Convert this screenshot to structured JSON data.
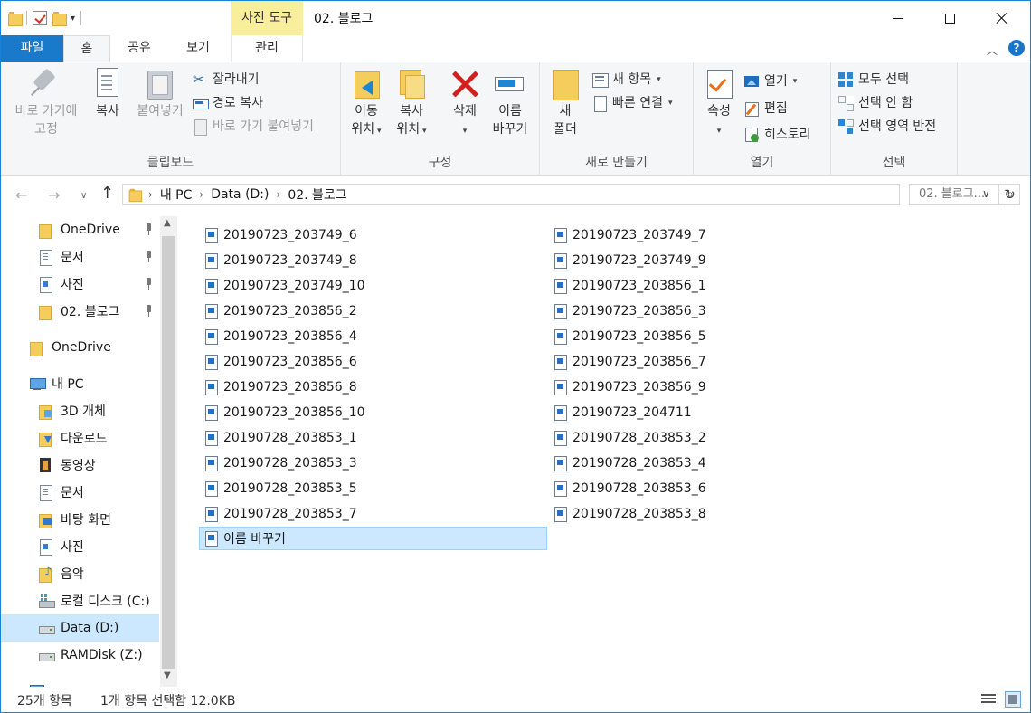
{
  "titlebar": {
    "contextual_tab": "사진 도구",
    "title": "02. 블로그"
  },
  "tabs": {
    "file": "파일",
    "home": "홈",
    "share": "공유",
    "view": "보기",
    "manage": "관리"
  },
  "ribbon": {
    "clipboard": {
      "label": "클립보드",
      "pin_line1": "바로 가기에",
      "pin_line2": "고정",
      "copy": "복사",
      "paste": "붙여넣기",
      "cut": "잘라내기",
      "copy_path": "경로 복사",
      "paste_shortcut": "바로 가기 붙여넣기"
    },
    "organize": {
      "label": "구성",
      "move_line1": "이동",
      "move_line2": "위치",
      "copy_line1": "복사",
      "copy_line2": "위치",
      "delete": "삭제",
      "rename_line1": "이름",
      "rename_line2": "바꾸기"
    },
    "new": {
      "label": "새로 만들기",
      "folder_line1": "새",
      "folder_line2": "폴더",
      "new_item": "새 항목",
      "easy_access": "빠른 연결"
    },
    "open": {
      "label": "열기",
      "properties": "속성",
      "open": "열기",
      "edit": "편집",
      "history": "히스토리"
    },
    "select": {
      "label": "선택",
      "select_all": "모두 선택",
      "select_none": "선택 안 함",
      "invert": "선택 영역 반전"
    }
  },
  "address": {
    "crumbs": [
      "내 PC",
      "Data (D:)",
      "02. 블로그"
    ],
    "search_placeholder": "02. 블로그..."
  },
  "nav": {
    "quick_onedrive": "OneDrive",
    "quick_docs": "문서",
    "quick_pics": "사진",
    "quick_blog": "02. 블로그",
    "onedrive": "OneDrive",
    "pc": "내 PC",
    "objects3d": "3D 개체",
    "downloads": "다운로드",
    "videos": "동영상",
    "docs": "문서",
    "desktop": "바탕 화면",
    "pics": "사진",
    "music": "음악",
    "local_c": "로컬 디스크 (C:)",
    "data_d": "Data (D:)",
    "ramdisk": "RAMDisk (Z:)"
  },
  "files": [
    "20190723_203749_6",
    "20190723_203749_7",
    "20190723_203749_8",
    "20190723_203749_9",
    "20190723_203749_10",
    "20190723_203856_1",
    "20190723_203856_2",
    "20190723_203856_3",
    "20190723_203856_4",
    "20190723_203856_5",
    "20190723_203856_6",
    "20190723_203856_7",
    "20190723_203856_8",
    "20190723_203856_9",
    "20190723_203856_10",
    "20190723_204711",
    "20190728_203853_1",
    "20190728_203853_2",
    "20190728_203853_3",
    "20190728_203853_4",
    "20190728_203853_5",
    "20190728_203853_6",
    "20190728_203853_7",
    "20190728_203853_8",
    "이름 바꾸기"
  ],
  "status": {
    "count": "25개 항목",
    "selection": "1개 항목 선택함 12.0KB"
  }
}
